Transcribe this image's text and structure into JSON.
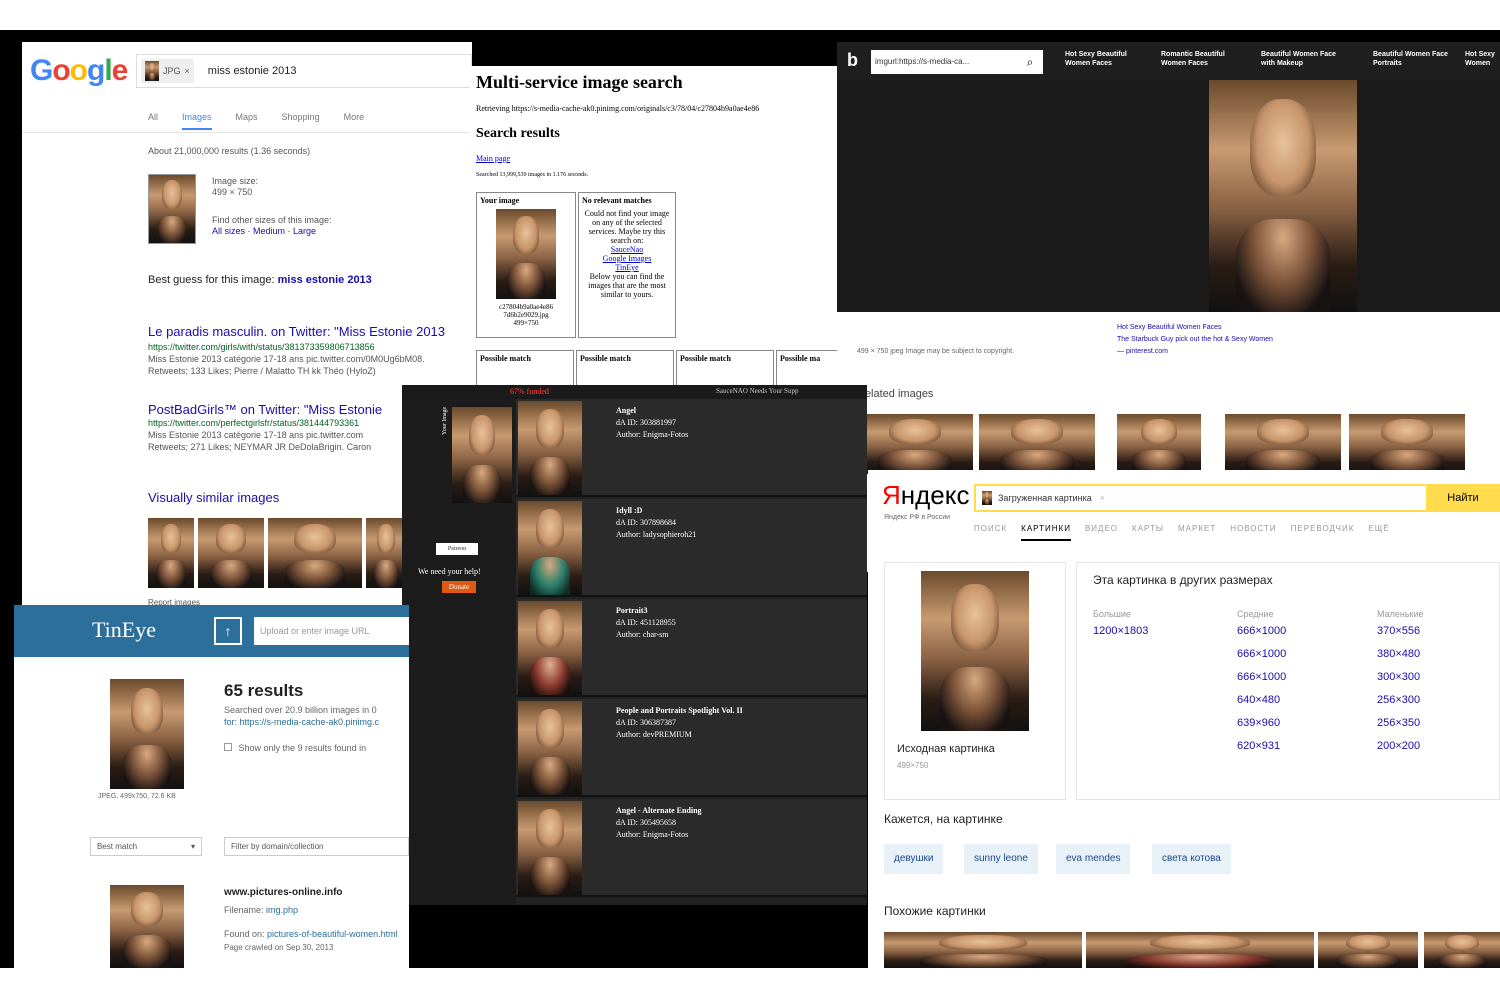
{
  "google": {
    "logo": [
      "G",
      "o",
      "o",
      "g",
      "l",
      "e"
    ],
    "chip": "JPG",
    "query": "miss estonie 2013",
    "tabs": [
      "All",
      "Images",
      "Maps",
      "Shopping",
      "More"
    ],
    "stats": "About 21,000,000 results (1.36 seconds)",
    "image_size_label": "Image size:",
    "image_size": "499 × 750",
    "other_sizes_label": "Find other sizes of this image:",
    "other_sizes_links": "All sizes · Medium · Large",
    "best_guess_label": "Best guess for this image:",
    "best_guess": "miss estonie 2013",
    "result1_title": "Le paradis masculin. on Twitter: \"Miss Estonie 2013",
    "result1_url": "https://twitter.com/girls/with/status/381373359806713856",
    "result1_snip1": "Miss Estonie 2013 catégorie 17-18 ans pic.twitter.com/0M0Ug6bM08.",
    "result1_snip2": "Retweets; 133 Likes; Pierre / Malatto TH kk Théo (HyloZ)",
    "result2_title": "PostBadGirls™ on Twitter: \"Miss Estonie",
    "result2_url": "https://twitter.com/perfectgirlsfr/status/381444793361",
    "result2_snip1": "Miss Estonie 2013 catégorie 17-18 ans pic.twitter.com",
    "result2_snip2": "Retweets; 271 Likes; NEYMAR JR DeDolaBrigin. Caron",
    "similar_title": "Visually similar images",
    "report": "Report images"
  },
  "multi": {
    "title": "Multi-service image search",
    "retrieving": "Retrieving https://s-media-cache-ak0.pinimg.com/originals/c3/78/04/c27804b9a0ae4e86",
    "results_title": "Search results",
    "main_page": "Main page",
    "searched": "Searched 13,999,539 images in 1.176 seconds.",
    "your_image": "Your image",
    "your_image_name": "c27804b9a0ae4e86 7d6b2e9029.jpg",
    "your_image_size": "499×750",
    "no_match_title": "No relevant matches",
    "no_match_text": "Could not find your image on any of the selected services. Maybe try this search on:",
    "links": [
      "SauceNao",
      "Google Images",
      "TinEye"
    ],
    "below_text": "Below you can find the images that are the most similar to yours.",
    "possible": [
      "Possible match",
      "Possible match",
      "Possible match",
      "Possible ma"
    ]
  },
  "bing": {
    "logo": "b",
    "search": "imgurl:https://s-media-ca...",
    "search_icon": "search-icon",
    "categories": [
      "Hot Sexy Beautiful Women Faces",
      "Romantic Beautiful Women Faces",
      "Beautiful Women Face with Makeup",
      "Beautiful Women Face Portraits",
      "Hot Sexy Women"
    ],
    "size_info": "499 × 750   jpeg   Image may be subject to copyright.",
    "source_title": "Hot Sexy Beautiful Women Faces",
    "source_desc": "The Starbuck Guy pick out the hot & Sexy Women",
    "source_site": "— pinterest.com",
    "related": "Related images"
  },
  "sauce": {
    "banner": "67% funded",
    "header": "SauceNAO Needs Your Supp",
    "side_label": "Your Image",
    "side_help": "We need your help!",
    "donate": "Donate",
    "patreon": "Patreon",
    "rows": [
      {
        "title": "Angel",
        "id": "dA ID: 303881997",
        "author": "Author: Enigma-Fotos"
      },
      {
        "title": "Idyll :D",
        "id": "dA ID: 307898684",
        "author": "Author: ladysophieroh21"
      },
      {
        "title": "Portrait3",
        "id": "dA ID: 451128955",
        "author": "Author: char-sm"
      },
      {
        "title": "People and Portraits Spotlight Vol. II",
        "id": "dA ID: 306387387",
        "author": "Author: devPREMIUM"
      },
      {
        "title": "Angel - Alternate Ending",
        "id": "dA ID: 305495658",
        "author": "Author: Enigma-Fotos"
      }
    ]
  },
  "tineye": {
    "logo": "TinEye",
    "upload_icon": "upload-icon",
    "input_placeholder": "Upload or enter image URL",
    "results": "65 results",
    "searched": "Searched over 20.9 billion images in 0",
    "for": "for: https://s-media-cache-ak0.pinimg.c",
    "checkbox": "Show only the 9 results found in",
    "thumb_info": "JPEG, 499x750, 72.6 KB",
    "sort": "Best match",
    "filter": "Filter by domain/collection",
    "site": "www.pictures-online.info",
    "filename_label": "Filename:",
    "filename": "img.php",
    "found_label": "Found on:",
    "found": "pictures-of-beautiful-women.html",
    "crawled": "Page crawled on Sep 30, 2013"
  },
  "yandex": {
    "logo_first": "Я",
    "logo_rest": "ндекс",
    "logo_sub": "Яндекс РФ в России",
    "search": "Загруженная картинка",
    "button": "Найти",
    "tabs": [
      "ПОИСК",
      "КАРТИНКИ",
      "ВИДЕО",
      "КАРТЫ",
      "МАРКЕТ",
      "НОВОСТИ",
      "ПЕРЕВОДЧИК",
      "ЕЩЁ"
    ],
    "original_label": "Исходная картинка",
    "original_size": "499×750",
    "other_sizes": "Эта картинка в других размерах",
    "col_large": "Большие",
    "col_medium": "Средние",
    "col_small": "Маленькие",
    "large": [
      "1200×1803"
    ],
    "medium": [
      "666×1000",
      "666×1000",
      "666×1000",
      "640×480",
      "639×960",
      "620×931"
    ],
    "small": [
      "370×556",
      "380×480",
      "300×300",
      "256×300",
      "256×350",
      "200×200"
    ],
    "seems": "Кажется, на картинке",
    "tags": [
      "девушки",
      "sunny leone",
      "eva mendes",
      "света котова"
    ],
    "similar": "Похожие картинки"
  }
}
